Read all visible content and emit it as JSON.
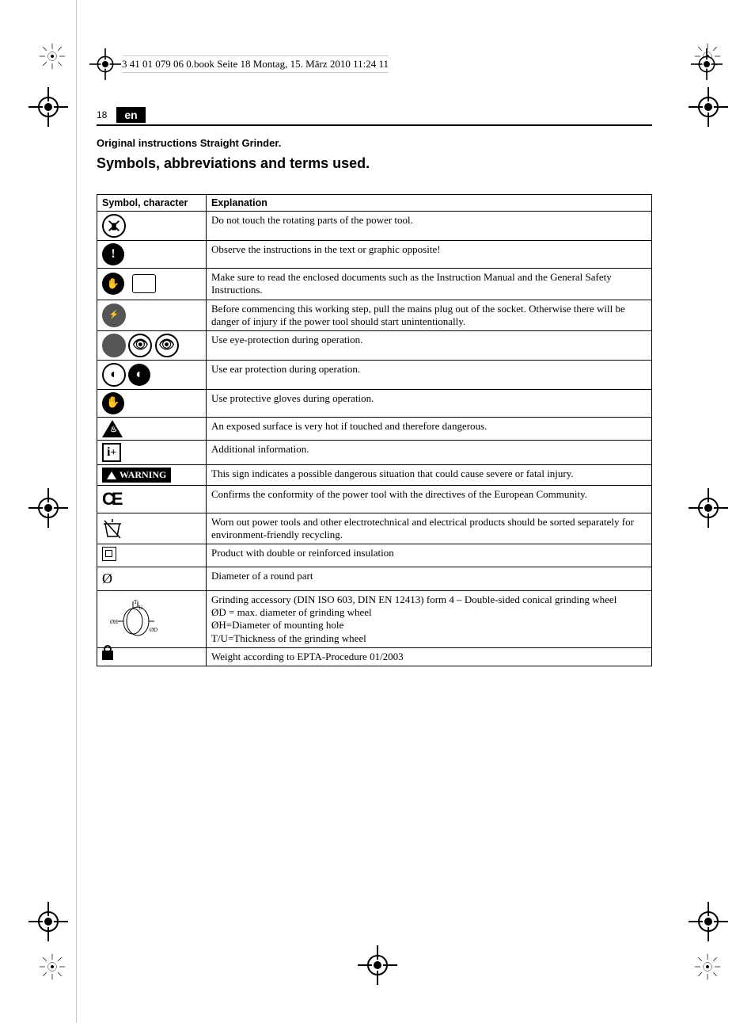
{
  "header_text": "3 41 01 079 06 0.book  Seite 18  Montag, 15. März 2010  11:24 11",
  "page_number": "18",
  "lang": "en",
  "subtitle": "Original instructions Straight Grinder.",
  "title": "Symbols, abbreviations and terms used.",
  "th_symbol": "Symbol, character",
  "th_expl": "Explanation",
  "rows": [
    {
      "icon": "no-touch",
      "expl": "Do not touch the rotating parts of the power tool."
    },
    {
      "icon": "exclaim",
      "expl": "Observe the instructions in the text or graphic opposite!"
    },
    {
      "icon": "docs",
      "expl": "Make sure to read the enclosed documents such as the Instruction Manual and the General Safety Instructions."
    },
    {
      "icon": "plug",
      "expl": "Before commencing this working step, pull the mains plug out of the socket. Otherwise there will be danger of injury if the power tool should start unintentionally."
    },
    {
      "icon": "eye",
      "expl": "Use eye-protection during operation."
    },
    {
      "icon": "ear",
      "expl": "Use ear protection during operation."
    },
    {
      "icon": "glove",
      "expl": "Use protective gloves during operation."
    },
    {
      "icon": "hot",
      "expl": "An exposed surface is very hot if touched and therefore dangerous."
    },
    {
      "icon": "info",
      "expl": "Additional information."
    },
    {
      "icon": "warning",
      "label": "WARNING",
      "expl": "This sign indicates a possible dangerous situation that could cause severe or fatal injury."
    },
    {
      "icon": "ce",
      "expl": "Confirms the conformity of the power tool with the directives of the European Community."
    },
    {
      "icon": "weee",
      "expl": "Worn out power tools and other electrotechnical and electrical products should be sorted separately for environment-friendly recycling."
    },
    {
      "icon": "dblins",
      "expl": "Product with double or reinforced insulation"
    },
    {
      "icon": "diam",
      "expl": "Diameter of a round part"
    },
    {
      "icon": "grind",
      "expl": "Grinding accessory (DIN ISO 603, DIN EN 12413) form 4 – Double-sided conical grinding wheel",
      "lines": [
        "ØD = max. diameter of grinding wheel",
        "ØH=Diameter of mounting hole",
        "T/U=Thickness of the grinding wheel"
      ]
    },
    {
      "icon": "weight",
      "expl": "Weight according to EPTA-Procedure 01/2003"
    }
  ]
}
